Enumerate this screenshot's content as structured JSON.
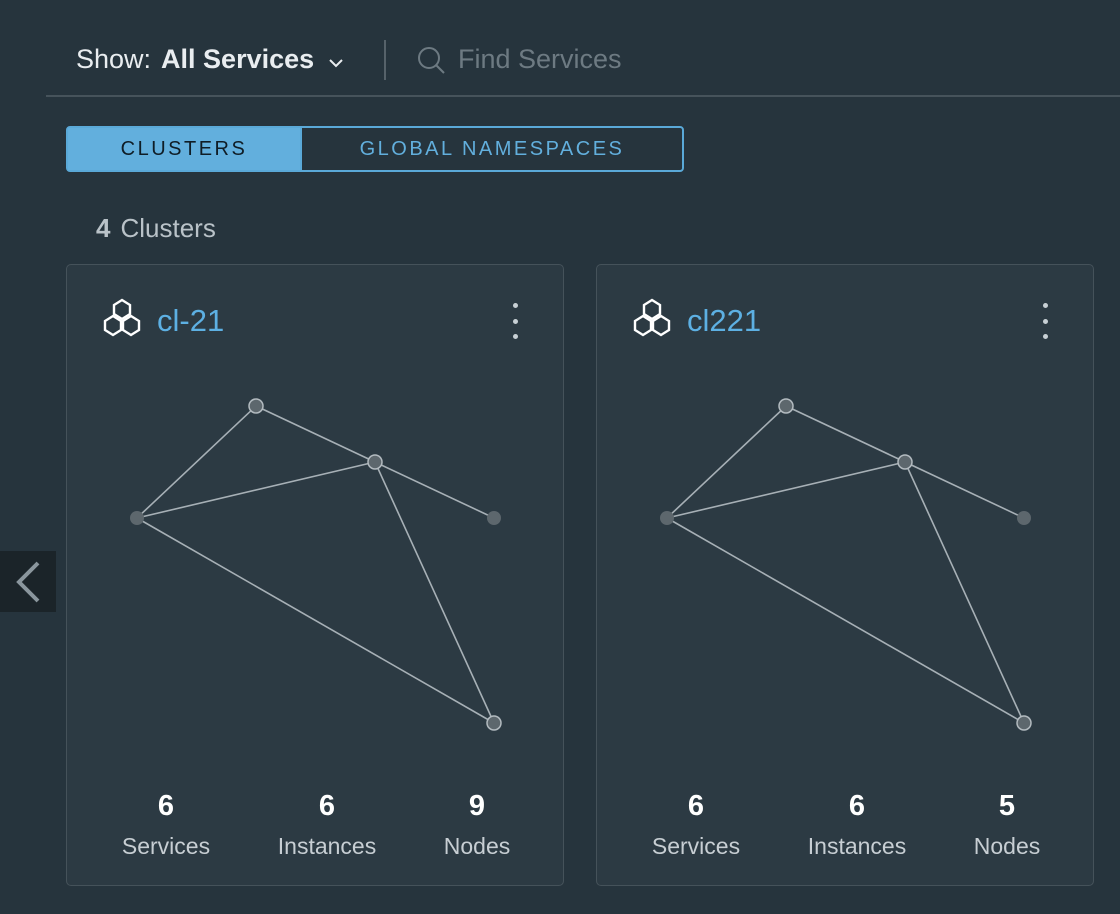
{
  "filter": {
    "show_label": "Show:",
    "show_value": "All Services"
  },
  "search": {
    "placeholder": "Find Services"
  },
  "view_tabs": {
    "clusters": "CLUSTERS",
    "global_namespaces": "GLOBAL NAMESPACES"
  },
  "summary": {
    "count": "4",
    "label": "Clusters"
  },
  "clusters": [
    {
      "name": "cl-21",
      "services": "6",
      "services_label": "Services",
      "instances": "6",
      "instances_label": "Instances",
      "nodes": "9",
      "nodes_label": "Nodes"
    },
    {
      "name": "cl221",
      "services": "6",
      "services_label": "Services",
      "instances": "6",
      "instances_label": "Instances",
      "nodes": "5",
      "nodes_label": "Nodes"
    }
  ],
  "icons": {
    "cluster": "hexagon-cluster-icon",
    "menu": "kebab-menu-icon",
    "search": "search-icon",
    "dropdown": "chevron-down-icon",
    "previous": "chevron-left-icon"
  },
  "colors": {
    "accent": "#5db0e3",
    "background": "#26343d",
    "card": "#2c3a43"
  }
}
